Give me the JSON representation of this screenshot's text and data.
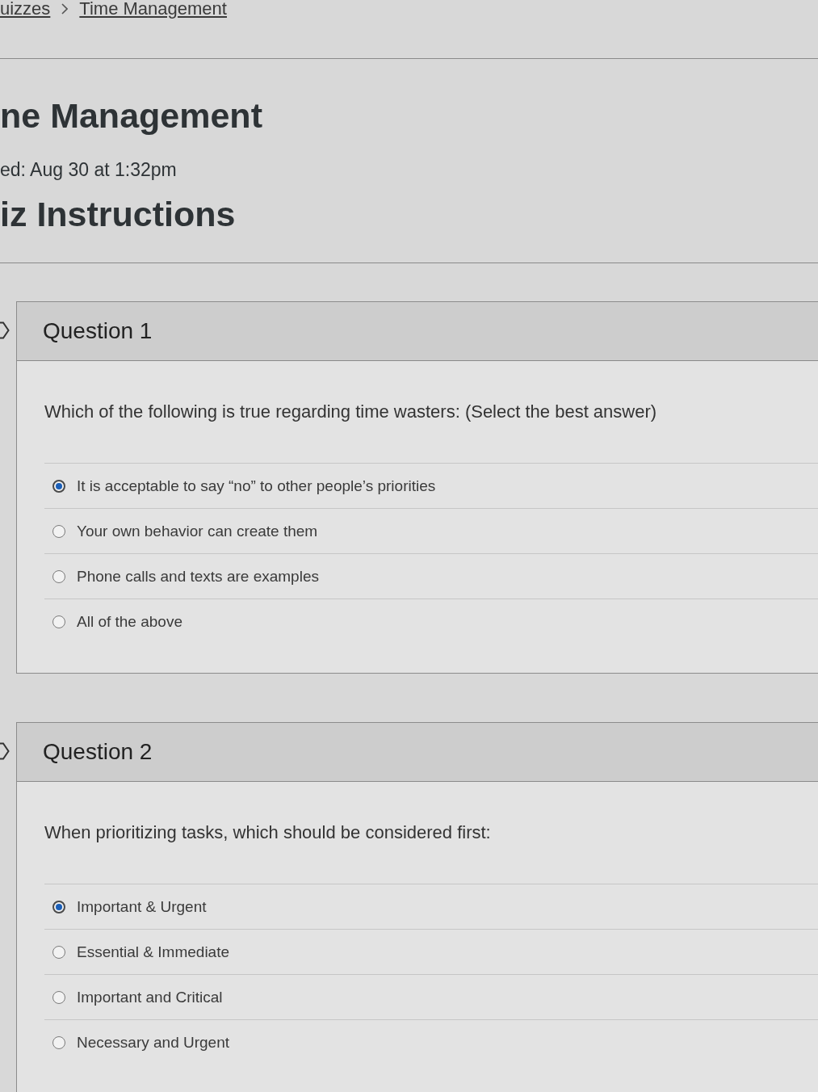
{
  "breadcrumb": [
    {
      "label": "uizzes"
    },
    {
      "label": "Time Management"
    }
  ],
  "header": {
    "title": "ne Management",
    "published": "ed: Aug 30 at 1:32pm",
    "instructions_heading": "iz Instructions"
  },
  "questions": [
    {
      "title": "Question 1",
      "text": "Which of the following is true regarding time wasters: (Select the best answer)",
      "answers": [
        {
          "label": "It is acceptable to say “no” to other people’s priorities",
          "selected": true
        },
        {
          "label": "Your own behavior can create them",
          "selected": false
        },
        {
          "label": "Phone calls and texts are examples",
          "selected": false
        },
        {
          "label": "All of the above",
          "selected": false
        }
      ]
    },
    {
      "title": "Question 2",
      "text": "When prioritizing tasks, which should be considered first:",
      "answers": [
        {
          "label": "Important & Urgent",
          "selected": true
        },
        {
          "label": "Essential & Immediate",
          "selected": false
        },
        {
          "label": "Important and Critical",
          "selected": false
        },
        {
          "label": "Necessary and Urgent",
          "selected": false
        }
      ]
    }
  ]
}
